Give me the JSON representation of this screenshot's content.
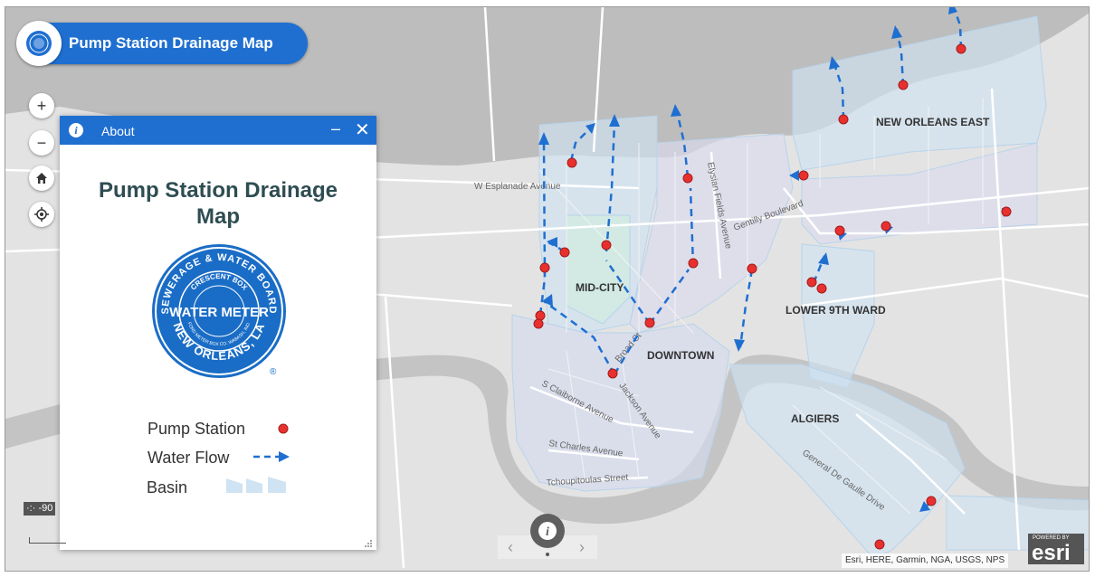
{
  "title": "Pump Station Drainage Map",
  "about": {
    "header": "About",
    "minimize": "–",
    "close": "✕",
    "heading": "Pump Station Drainage Map",
    "logo_text_top": "SEWERAGE & WATER BOARD",
    "logo_text_inner": "CRESCENT BOX",
    "logo_text_center": "WATER METER",
    "logo_text_inner2": "FORD METER BOX CO. WABASH, IND.",
    "logo_text_bottom": "NEW ORLEANS, LA",
    "logo_reg": "®",
    "legend": [
      {
        "label": "Pump Station",
        "symbol": "red-dot"
      },
      {
        "label": "Water Flow",
        "symbol": "blue-dashed-arrow"
      },
      {
        "label": "Basin",
        "symbol": "basin-swatch"
      }
    ]
  },
  "controls": {
    "zoom_in": "+",
    "zoom_out": "−",
    "home_icon": "home-icon",
    "locate_icon": "locate-icon"
  },
  "map_labels": {
    "neighborhoods": [
      "NEW ORLEANS EAST",
      "MID-CITY",
      "DOWNTOWN",
      "LOWER 9TH WARD",
      "ALGIERS"
    ],
    "streets": [
      "W Esplanade Avenue",
      "Elysian Fields Avenue",
      "Gentilly Boulevard",
      "S Claiborne Avenue",
      "Jackson Avenue",
      "St Charles Avenue",
      "Tchoupitoulas Street",
      "General De Gaulle Drive",
      "Broad St"
    ]
  },
  "status": {
    "coordinates": "-90",
    "scale_unit": "1mi"
  },
  "nav": {
    "prev": "‹",
    "next": "›"
  },
  "attribution": "Esri, HERE, Garmin, NGA, USGS, NPS",
  "esri": {
    "powered": "POWERED BY",
    "logo": "esri"
  },
  "colors": {
    "header_blue": "#1f6fd1",
    "pump_red": "#e8312f",
    "flow_blue": "#1f6fd1",
    "water": "#bdbdbd",
    "land": "#e3e3e3",
    "basin": "#cfe3f2"
  }
}
